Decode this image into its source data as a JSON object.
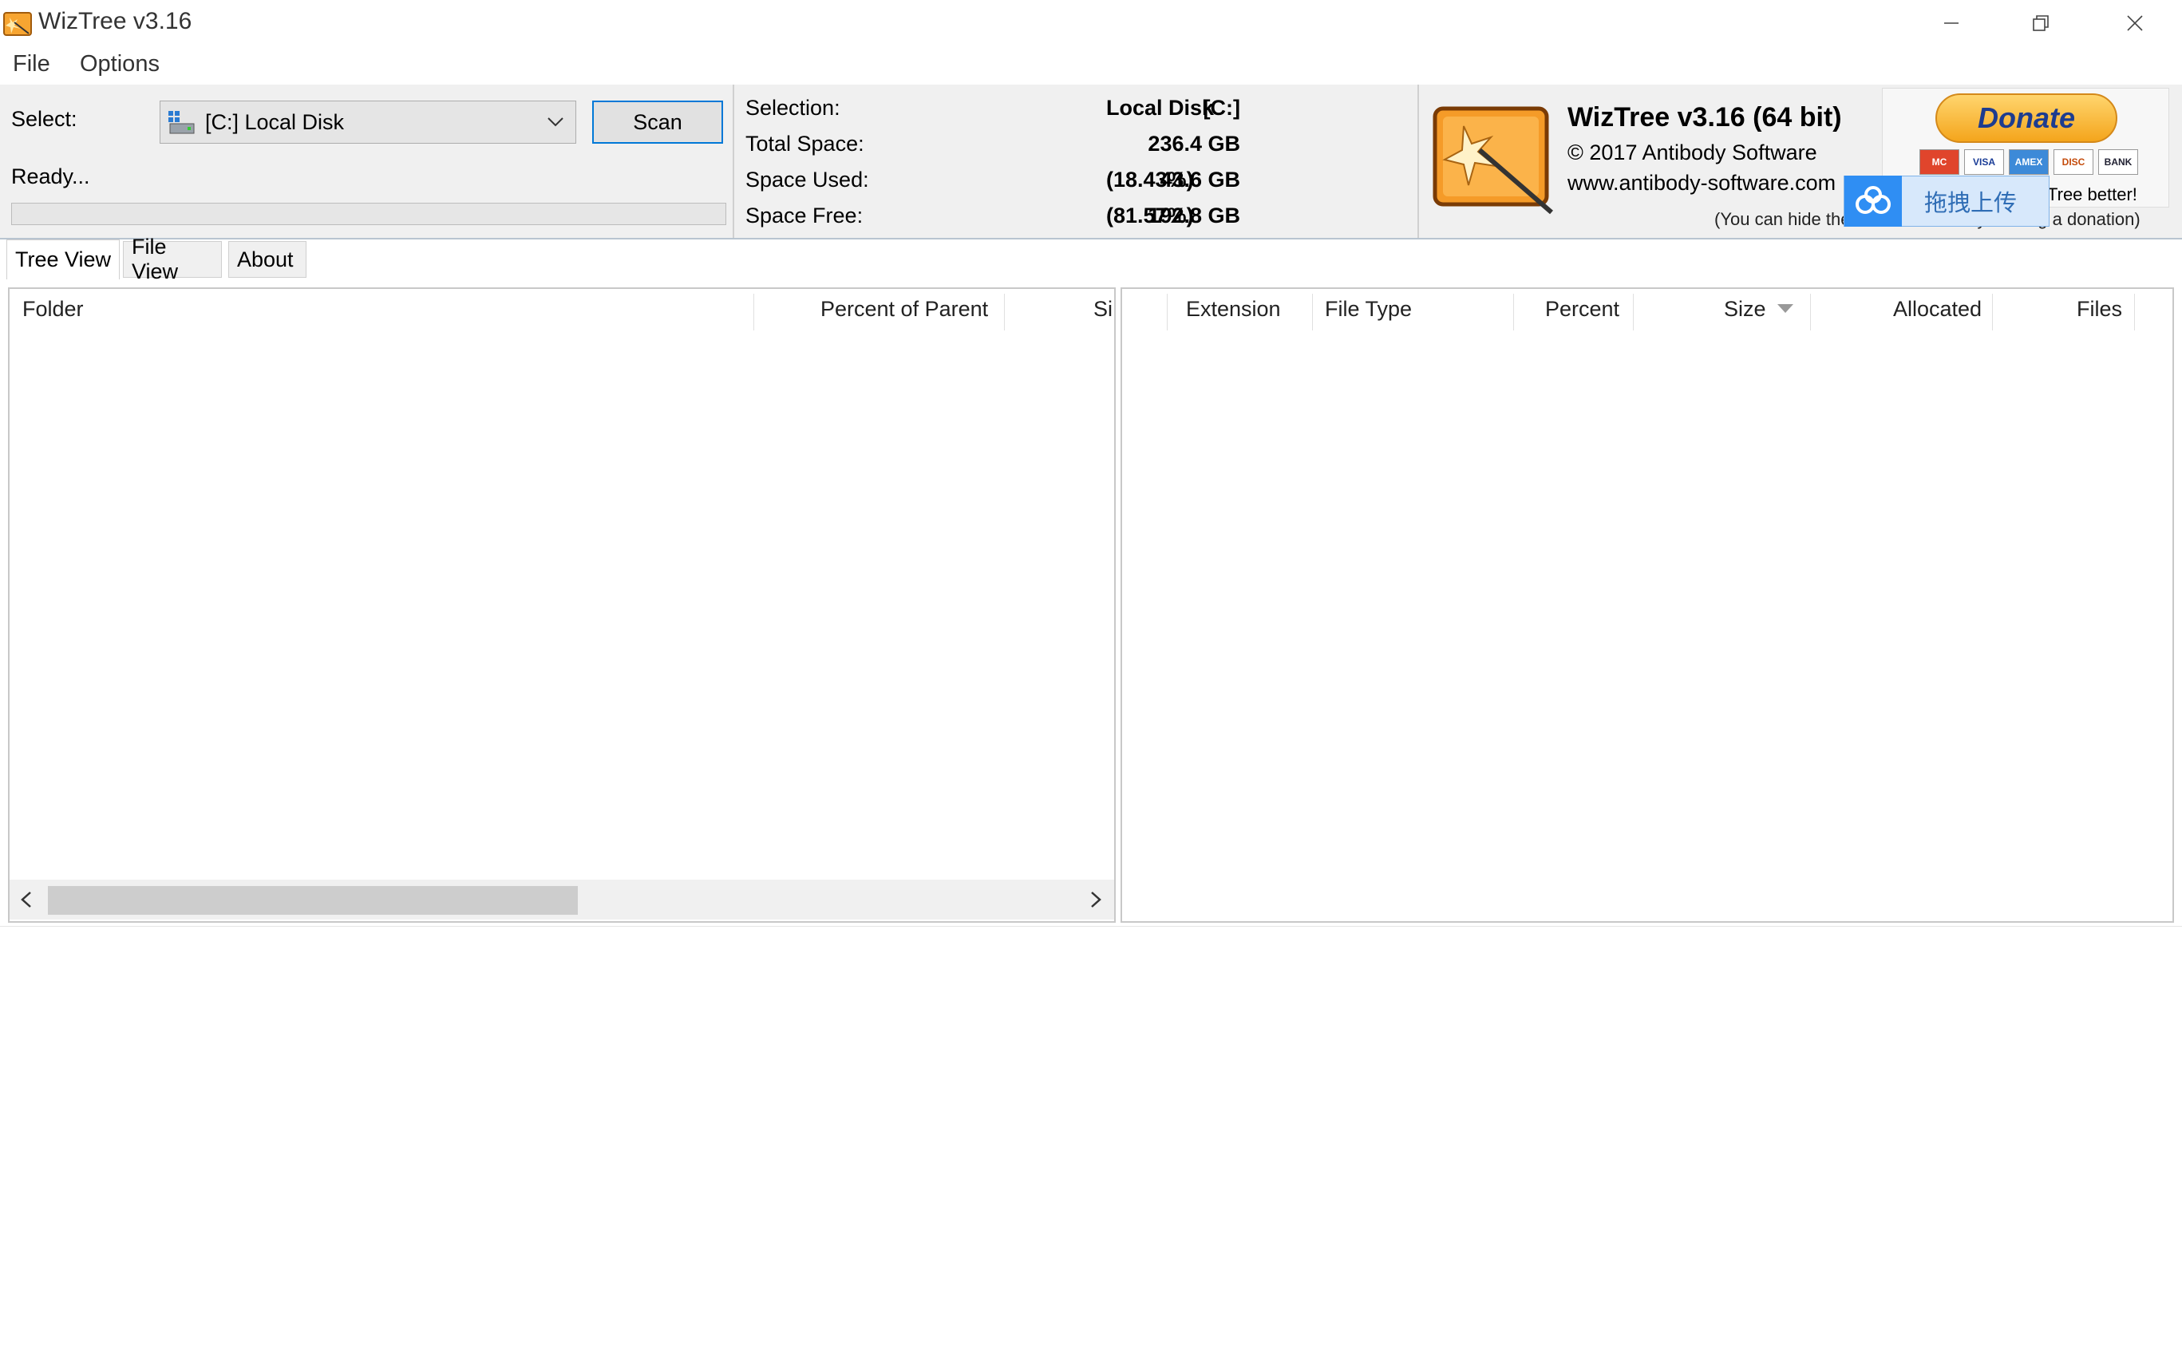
{
  "window": {
    "title": "WizTree v3.16",
    "icon": "wiztree-app-icon"
  },
  "menu": {
    "items": [
      "File",
      "Options"
    ]
  },
  "scan": {
    "select_label": "Select:",
    "drive_value": "[C:] Local Disk",
    "drive_icon": "drive-icon",
    "scan_button": "Scan",
    "status": "Ready..."
  },
  "selection": {
    "selection_label": "Selection:",
    "selection_drive": "[C:]",
    "selection_name": "Local Disk",
    "total_label": "Total Space:",
    "total_value": "236.4 GB",
    "used_label": "Space Used:",
    "used_value": "43.6 GB",
    "used_pct": "(18.43%)",
    "free_label": "Space Free:",
    "free_value": "192.8 GB",
    "free_pct": "(81.57%)"
  },
  "about": {
    "title": "WizTree v3.16 (64 bit)",
    "copyright": "© 2017 Antibody Software",
    "url": "www.antibody-software.com",
    "hint": "(You can hide the donate button by making a donation)",
    "donate": "Donate",
    "cards": [
      "MC",
      "VISA",
      "AMEX",
      "DISC",
      "BANK"
    ],
    "tree_better": "Tree better!"
  },
  "overlay": {
    "baidu_label": "拖拽上传",
    "baidu_icon": "cloud-upload-icon"
  },
  "tabs": [
    "Tree View",
    "File View",
    "About"
  ],
  "tree_columns": [
    "Folder",
    "Percent of Parent",
    "Si"
  ],
  "ext_columns": [
    "Extension",
    "File Type",
    "Percent",
    "Size",
    "Allocated",
    "Files"
  ],
  "colors": {
    "accent": "#0078d7",
    "donate_gold": "#f4a51c",
    "donate_text": "#1d3c8f"
  }
}
